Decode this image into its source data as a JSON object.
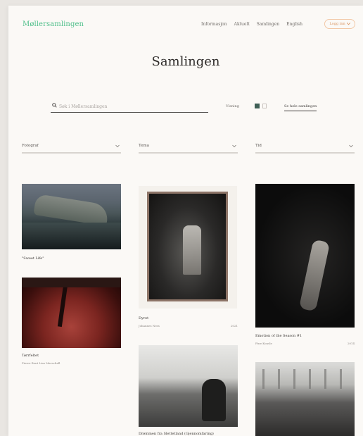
{
  "header": {
    "logo": "Møllersamlingen",
    "nav": [
      "Informasjon",
      "Aktuelt",
      "Samlingen",
      "English"
    ],
    "login_label": "Logg inn"
  },
  "page_title": "Samlingen",
  "search": {
    "placeholder": "Søk i Møllersamlingen",
    "visning_label": "Visning",
    "see_all_label": "Se hele samlingen"
  },
  "filters": [
    {
      "label": "Fotograf"
    },
    {
      "label": "Tema"
    },
    {
      "label": "Tid"
    }
  ],
  "cards": [
    {
      "title": "\"Sweet Life\""
    },
    {
      "title": "Tørrfeltet",
      "subtitle": "Pierre Bent Lisa Marschall"
    },
    {
      "title": "Dyret",
      "subtitle": "Johannes Ness",
      "year": "2021"
    },
    {
      "title": "Drømmen fra Slettetland (Gjennomfaring)",
      "subtitle": ""
    },
    {
      "title": "Emotion of the Season #1",
      "subtitle": "Fine Konsle",
      "year": "2014"
    },
    {
      "title": "",
      "subtitle": ""
    }
  ],
  "icons": {
    "search": "search-icon",
    "chevron": "chevron-down-icon",
    "grid_view": "grid-view-icon",
    "list_view": "list-view-icon"
  },
  "colors": {
    "logo": "#4fbf8a",
    "login_border": "#f2c9a8",
    "accent_dark": "#3f5f55",
    "background": "#fbf9f6"
  }
}
